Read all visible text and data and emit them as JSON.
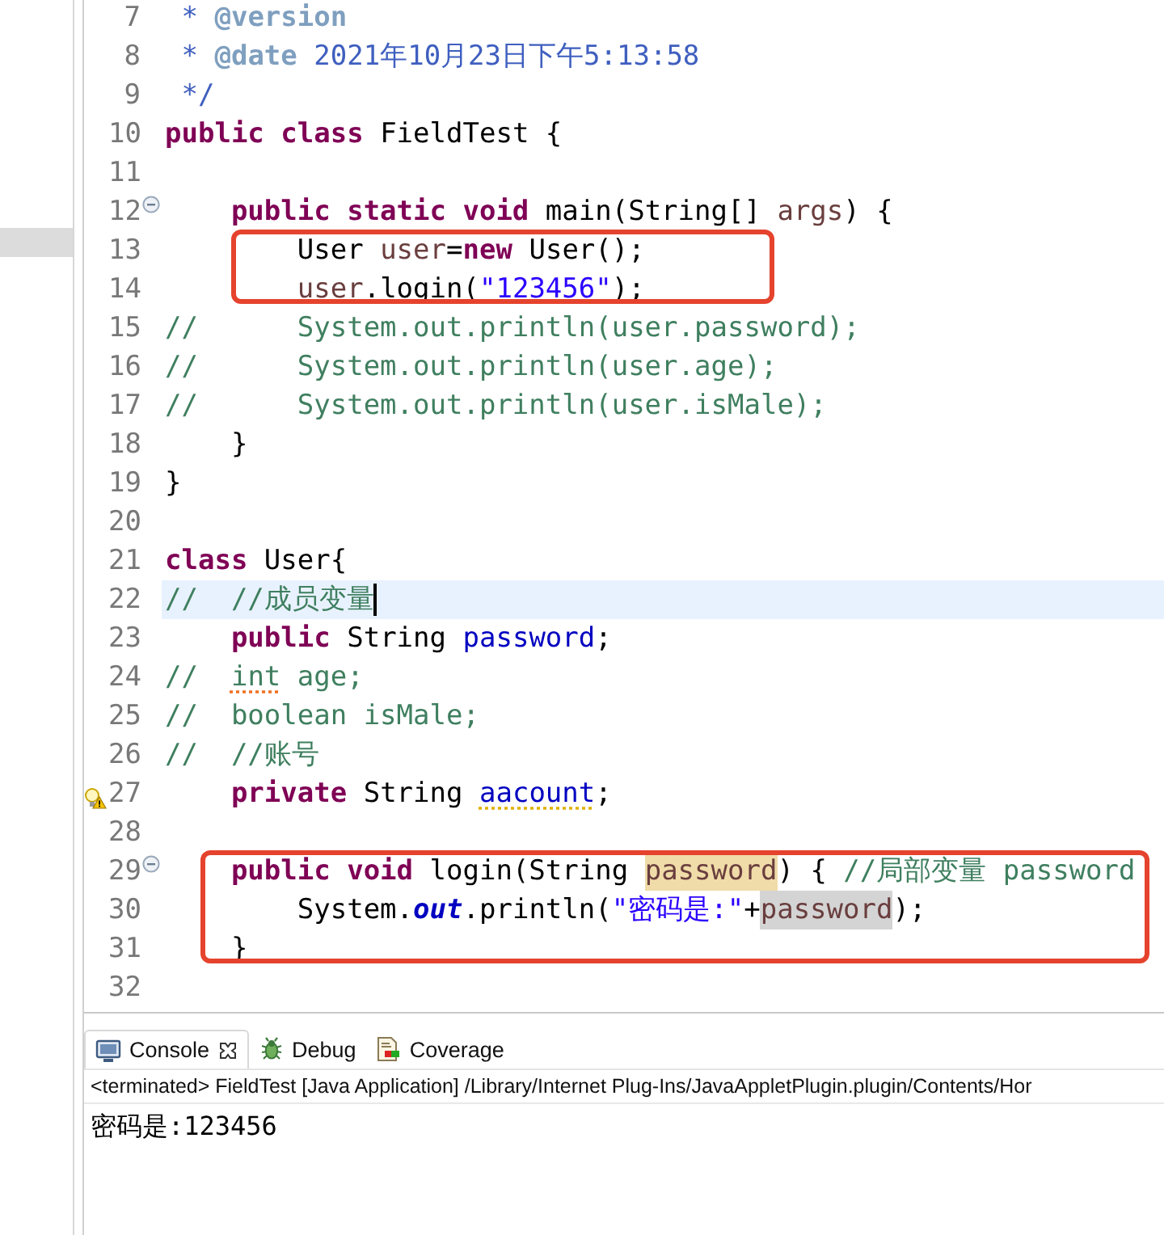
{
  "editor": {
    "lines": [
      {
        "number": "7",
        "tokens": [
          {
            "t": " *",
            "kind": "doc"
          },
          {
            "t": " @version",
            "kind": "doctag"
          }
        ]
      },
      {
        "number": "8",
        "tokens": [
          {
            "t": " *",
            "kind": "doc"
          },
          {
            "t": " @date",
            "kind": "doctag"
          },
          {
            "t": " 2021年10月23日下午5:13:58",
            "kind": "doc"
          }
        ]
      },
      {
        "number": "9",
        "tokens": [
          {
            "t": " */",
            "kind": "doc"
          }
        ]
      },
      {
        "number": "10",
        "tokens": [
          {
            "t": "public class",
            "kind": "kw"
          },
          {
            "t": " FieldTest {",
            "kind": "plain"
          }
        ]
      },
      {
        "number": "11"
      },
      {
        "number": "12",
        "foldable": true,
        "tokens": [
          {
            "t": "    public static void",
            "kind": "kw"
          },
          {
            "t": " main(String[]",
            "kind": "plain"
          },
          {
            "t": " args",
            "kind": "var"
          },
          {
            "t": ") {",
            "kind": "plain"
          }
        ]
      },
      {
        "number": "13",
        "boxed": true,
        "tokens": [
          {
            "t": "        User",
            "kind": "plain"
          },
          {
            "t": " user",
            "kind": "var"
          },
          {
            "t": "=",
            "kind": "plain"
          },
          {
            "t": "new",
            "kind": "kw"
          },
          {
            "t": " User();",
            "kind": "plain"
          }
        ]
      },
      {
        "number": "14",
        "boxed": true,
        "tokens": [
          {
            "t": "        user",
            "kind": "var"
          },
          {
            "t": ".login(",
            "kind": "plain"
          },
          {
            "t": "\"123456\"",
            "kind": "str"
          },
          {
            "t": ");",
            "kind": "plain"
          }
        ]
      },
      {
        "number": "15",
        "tokens": [
          {
            "t": "//      System.out.println(user.password);",
            "kind": "comment"
          }
        ]
      },
      {
        "number": "16",
        "tokens": [
          {
            "t": "//      System.out.println(user.age);",
            "kind": "comment"
          }
        ]
      },
      {
        "number": "17",
        "tokens": [
          {
            "t": "//      System.out.println(user.isMale);",
            "kind": "comment"
          }
        ]
      },
      {
        "number": "18",
        "tokens": [
          {
            "t": "    }",
            "kind": "plain"
          }
        ]
      },
      {
        "number": "19",
        "tokens": [
          {
            "t": "}",
            "kind": "plain"
          }
        ]
      },
      {
        "number": "20"
      },
      {
        "number": "21",
        "tokens": [
          {
            "t": "class",
            "kind": "kw"
          },
          {
            "t": " User{",
            "kind": "plain"
          }
        ]
      },
      {
        "number": "22",
        "current": true,
        "tokens": [
          {
            "t": "//  //成员变量",
            "kind": "comment"
          }
        ]
      },
      {
        "number": "23",
        "tokens": [
          {
            "t": "    public",
            "kind": "kw"
          },
          {
            "t": " String",
            "kind": "plain"
          },
          {
            "t": " password",
            "kind": "field"
          },
          {
            "t": ";",
            "kind": "plain"
          }
        ]
      },
      {
        "number": "24",
        "tokens": [
          {
            "t": "//  ",
            "kind": "comment"
          },
          {
            "t": "int",
            "kind": "comment",
            "spelling_error": true
          },
          {
            "t": " age;",
            "kind": "comment"
          }
        ]
      },
      {
        "number": "25",
        "tokens": [
          {
            "t": "//  boolean isMale;",
            "kind": "comment"
          }
        ]
      },
      {
        "number": "26",
        "tokens": [
          {
            "t": "//  //账号",
            "kind": "comment"
          }
        ]
      },
      {
        "number": "27",
        "warning": true,
        "tokens": [
          {
            "t": "    private",
            "kind": "kw"
          },
          {
            "t": " String ",
            "kind": "plain"
          },
          {
            "t": "aacount",
            "kind": "field",
            "warning_underline": true
          },
          {
            "t": ";",
            "kind": "plain"
          }
        ]
      },
      {
        "number": "28"
      },
      {
        "number": "29",
        "foldable": true,
        "boxed": true,
        "tokens": [
          {
            "t": "    public void",
            "kind": "kw"
          },
          {
            "t": " login(String ",
            "kind": "plain"
          },
          {
            "t": "password",
            "kind": "var",
            "write_occurrence": true
          },
          {
            "t": ") {",
            "kind": "plain"
          },
          {
            "t": " //局部变量 password",
            "kind": "comment"
          }
        ]
      },
      {
        "number": "30",
        "boxed": true,
        "tokens": [
          {
            "t": "        System.",
            "kind": "plain"
          },
          {
            "t": "out",
            "kind": "static"
          },
          {
            "t": ".println(",
            "kind": "plain"
          },
          {
            "t": "\"密码是:\"",
            "kind": "str"
          },
          {
            "t": "+",
            "kind": "plain"
          },
          {
            "t": "password",
            "kind": "var",
            "read_occurrence": true
          },
          {
            "t": ");",
            "kind": "plain"
          }
        ]
      },
      {
        "number": "31",
        "boxed": true,
        "tokens": [
          {
            "t": "    }",
            "kind": "plain"
          }
        ]
      },
      {
        "number": "32"
      }
    ]
  },
  "console": {
    "tabs": [
      {
        "label": "Console",
        "selected": true,
        "closable": true
      },
      {
        "label": "Debug",
        "selected": false,
        "closable": false
      },
      {
        "label": "Coverage",
        "selected": false,
        "closable": false
      }
    ],
    "header": "<terminated> FieldTest [Java Application] /Library/Internet Plug-Ins/JavaAppletPlugin.plugin/Contents/Hor",
    "output": "密码是:123456"
  }
}
